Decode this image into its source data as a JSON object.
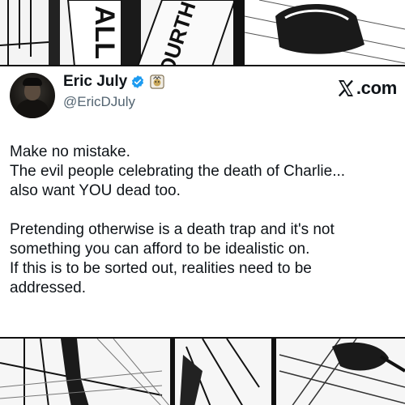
{
  "tweet": {
    "display_name": "Eric July",
    "handle": "@EricDJuly",
    "source_label": ".com",
    "verified_icon": "verified-badge-icon",
    "affiliation_icon": "affiliation-badge-icon",
    "paragraphs": [
      {
        "lines": [
          "Make no mistake.",
          "The evil people celebrating the death of Charlie...",
          "also want YOU dead too."
        ]
      },
      {
        "lines": [
          "Pretending otherwise is a death trap and it's not",
          "something you can afford to be idealistic on.",
          "If this is to be sorted out, realities need to be",
          "addressed."
        ]
      }
    ]
  },
  "strip_top": {
    "sign_text": "FOURTH W",
    "small_text": "ALL"
  },
  "colors": {
    "text": "#0f1419",
    "secondary": "#536471",
    "verified": "#1d9bf0"
  }
}
